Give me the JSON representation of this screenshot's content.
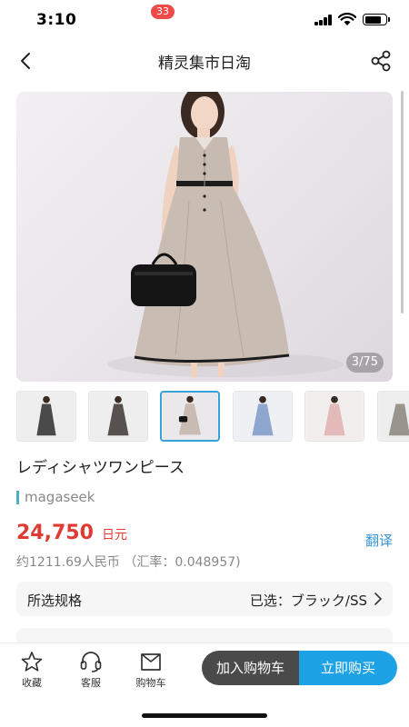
{
  "status_bar": {
    "time": "3:10"
  },
  "nav": {
    "title": "精灵集市日淘"
  },
  "gallery": {
    "counter": "3/75",
    "selected_index": 3,
    "thumbnail_count": 6
  },
  "product": {
    "title": "レディシャツワンピース",
    "brand": "magaseek",
    "price": "24,750",
    "currency": "日元",
    "translate_label": "翻译",
    "rmb_note": "约1211.69人民币 （汇率：0.048957)"
  },
  "spec": {
    "label": "所选规格",
    "selected": "已选：ブラック/SS"
  },
  "bottom_bar": {
    "tabs": [
      {
        "label": "收藏",
        "icon": "star-icon"
      },
      {
        "label": "客服",
        "icon": "headset-icon"
      },
      {
        "label": "购物车",
        "icon": "cart-icon"
      }
    ],
    "cart_badge": "33",
    "add_to_cart": "加入购物车",
    "buy_now": "立即购买"
  },
  "colors": {
    "price": "#e03a33",
    "accent_blue": "#1ea2e6",
    "link_blue": "#3a98d6",
    "dark_button": "#4a4a4a",
    "badge_red": "#ee4a4a",
    "brand_bar": "#4ab0c2"
  }
}
